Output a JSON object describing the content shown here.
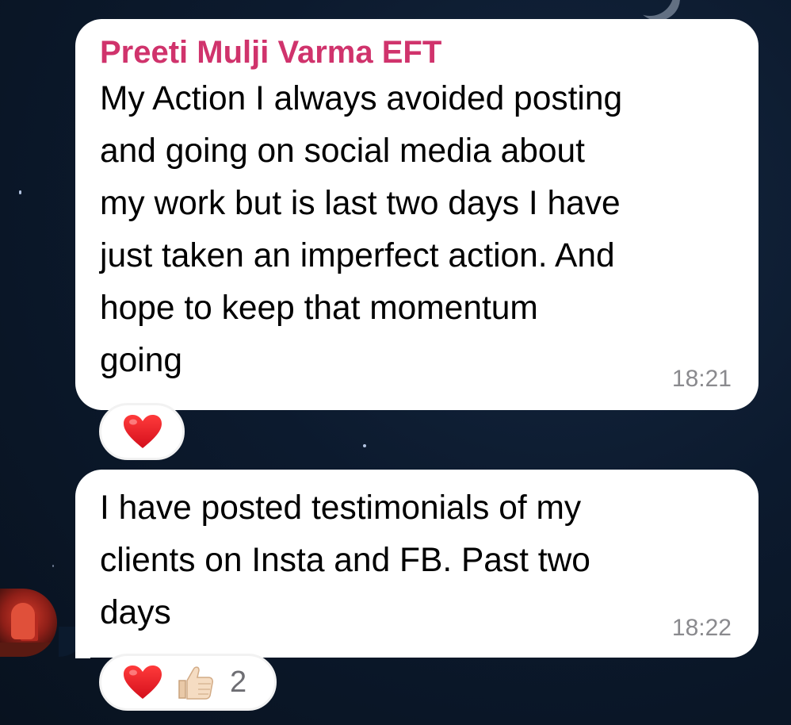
{
  "messages": [
    {
      "sender": "Preeti Mulji Varma EFT",
      "text": "My Action I always avoided posting\nand going on social media about\nmy work but is last two days I have\njust taken an imperfect action. And\nhope to keep that momentum\ngoing",
      "time": "18:21",
      "reactions": [
        {
          "icon": "red-heart-icon"
        }
      ]
    },
    {
      "text": "I have posted testimonials of my\nclients on Insta and FB. Past two\ndays",
      "time": "18:22",
      "reactions": [
        {
          "icon": "red-heart-icon"
        },
        {
          "icon": "thumbs-up-icon",
          "count": "2"
        }
      ]
    }
  ],
  "colors": {
    "sender_name": "#d0336c",
    "bubble": "#ffffff",
    "timestamp": "#8a8a8e",
    "background": "#0c1a2e"
  }
}
